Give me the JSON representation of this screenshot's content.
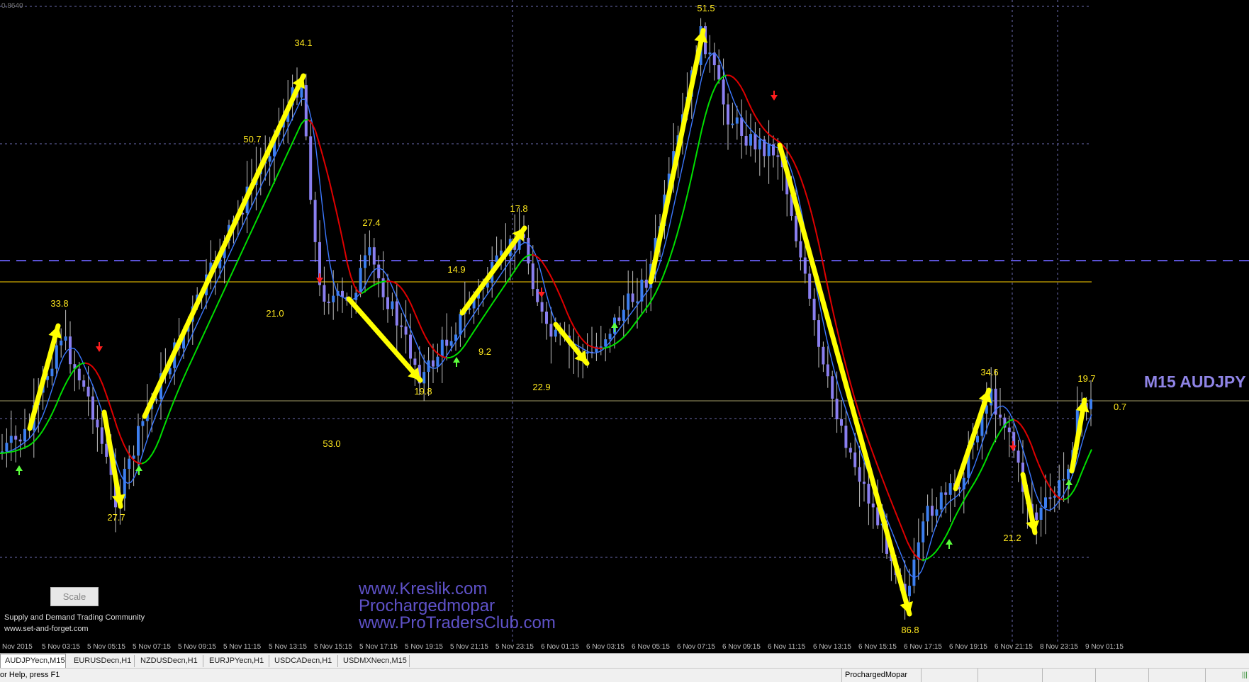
{
  "chart": {
    "top_price_label": "0.8640",
    "symbol_label": "M15 AUDJPY",
    "side_value": "0.7",
    "scale_button": "Scale",
    "community": "Supply and Demand Trading Community",
    "community_site": "www.set-and-forget.com",
    "watermark": [
      "www.Kreslik.com",
      "Prochargedmopar",
      "www.ProTradersClub.com"
    ],
    "colors": {
      "background": "#000000",
      "candle_up": "#3d7ff0",
      "candle_down": "#8a7ff0",
      "wick": "#c0c0c0",
      "ma_fast": "#3c78ff",
      "ma_slow_up": "#00e000",
      "ma_slow_down": "#e00000",
      "arrows": "#ffff00",
      "level_line": "#ffd200",
      "dashed_level": "#5b53d6",
      "grid": "#6b6bb0"
    },
    "move_labels": [
      "51.5",
      "34.1",
      "50.7",
      "27.4",
      "17.8",
      "14.9",
      "33.8",
      "21.0",
      "9.2",
      "19.8",
      "22.9",
      "53.0",
      "27.7",
      "34.6",
      "19.7",
      "21.2",
      "86.8"
    ],
    "signal_arrows": [
      "down-arrow",
      "down-arrow",
      "down-arrow",
      "down-arrow",
      "down-arrow",
      "up-arrow",
      "up-arrow",
      "up-arrow",
      "up-arrow",
      "up-arrow",
      "up-arrow"
    ]
  },
  "time_axis": {
    "ticks": [
      "Nov 2015",
      "5 Nov 03:15",
      "5 Nov 05:15",
      "5 Nov 07:15",
      "5 Nov 09:15",
      "5 Nov 11:15",
      "5 Nov 13:15",
      "5 Nov 15:15",
      "5 Nov 17:15",
      "5 Nov 19:15",
      "5 Nov 21:15",
      "5 Nov 23:15",
      "6 Nov 01:15",
      "6 Nov 03:15",
      "6 Nov 05:15",
      "6 Nov 07:15",
      "6 Nov 09:15",
      "6 Nov 11:15",
      "6 Nov 13:15",
      "6 Nov 15:15",
      "6 Nov 17:15",
      "6 Nov 19:15",
      "6 Nov 21:15",
      "8 Nov 23:15",
      "9 Nov 01:15"
    ]
  },
  "tabs": [
    "AUDJPYecn,M15",
    "EURUSDecn,H1",
    "NZDUSDecn,H1",
    "EURJPYecn,H1",
    "USDCADecn,H1",
    "USDMXNecn,M15"
  ],
  "status": {
    "help": "or Help, press F1",
    "user": "ProchargedMopar"
  }
}
